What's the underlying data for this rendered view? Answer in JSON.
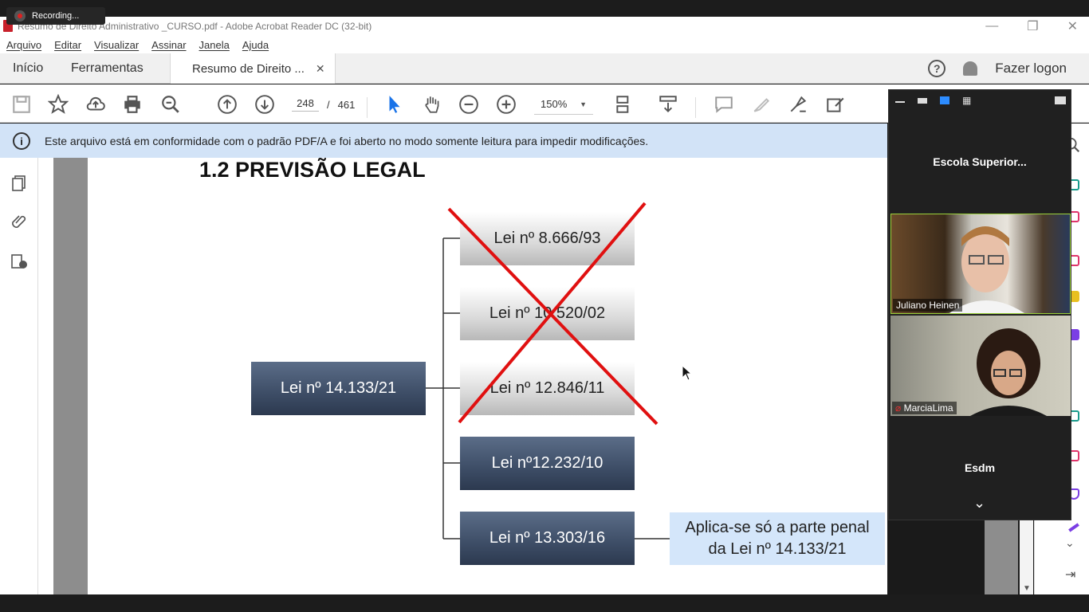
{
  "recording": {
    "label": "Recording..."
  },
  "window": {
    "title": "Resumo de Direito Administrativo _CURSO.pdf - Adobe Acrobat Reader DC (32-bit)",
    "minimize": "—",
    "restore": "❐",
    "close": "✕"
  },
  "menu": [
    "Arquivo",
    "Editar",
    "Visualizar",
    "Assinar",
    "Janela",
    "Ajuda"
  ],
  "tabs": {
    "home": "Início",
    "tools": "Ferramentas",
    "doc": "Resumo de Direito ...",
    "close": "✕",
    "login": "Fazer logon",
    "help": "?"
  },
  "toolbar": {
    "page_current": "248",
    "page_sep": "/",
    "page_total": "461",
    "zoom": "150%"
  },
  "infobar": {
    "icon": "i",
    "text": "Este arquivo está em conformidade com o padrão PDF/A e foi aberto no modo somente leitura para impedir modificações."
  },
  "slide": {
    "title": "1.2 PREVISÃO LEGAL",
    "root": "Lei nº 14.133/21",
    "laws": [
      "Lei nº 8.666/93",
      "Lei nº 10.520/02",
      "Lei nº 12.846/11",
      "Lei nº12.232/10",
      "Lei nº 13.303/16"
    ],
    "note_line1": "Aplica-se só a parte penal",
    "note_line2": "da Lei nº 14.133/21"
  },
  "zoom_panel": {
    "top_name": "Escola  Superior...",
    "participant1": "Juliano Heinen",
    "participant2": "MarciaLima",
    "bottom_name": "Esdm",
    "chevron": "⌄"
  },
  "colors": {
    "infobar_bg": "#d2e3f7",
    "dark_box": "#3d4d66",
    "cross_red": "#e01010",
    "note_bg": "#d4e6fa"
  }
}
